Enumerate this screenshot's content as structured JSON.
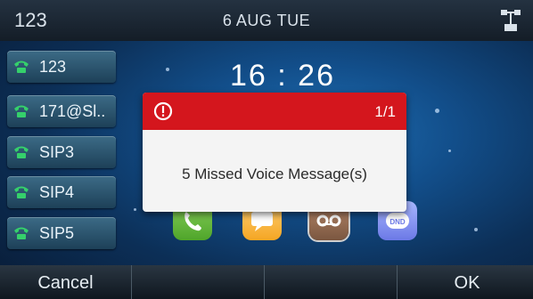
{
  "status_bar": {
    "account": "123",
    "date": "6 AUG TUE",
    "network_icon": "network-icon"
  },
  "clock": {
    "time": "16 : 26"
  },
  "lines": [
    {
      "label": "123",
      "icon": "phone-icon"
    },
    {
      "label": "171@Sl..",
      "icon": "phone-icon"
    },
    {
      "label": "SIP3",
      "icon": "phone-icon"
    },
    {
      "label": "SIP4",
      "icon": "phone-icon"
    },
    {
      "label": "SIP5",
      "icon": "phone-icon"
    }
  ],
  "apps": [
    {
      "icon": "call-app-icon"
    },
    {
      "icon": "messages-app-icon"
    },
    {
      "icon": "voicemail-app-icon"
    },
    {
      "icon": "dnd-app-icon",
      "text": "DND"
    }
  ],
  "popup": {
    "count": "1/1",
    "message": "5 Missed Voice Message(s)",
    "header_color": "#d4161d"
  },
  "softkeys": [
    "Cancel",
    "",
    "",
    "OK"
  ]
}
